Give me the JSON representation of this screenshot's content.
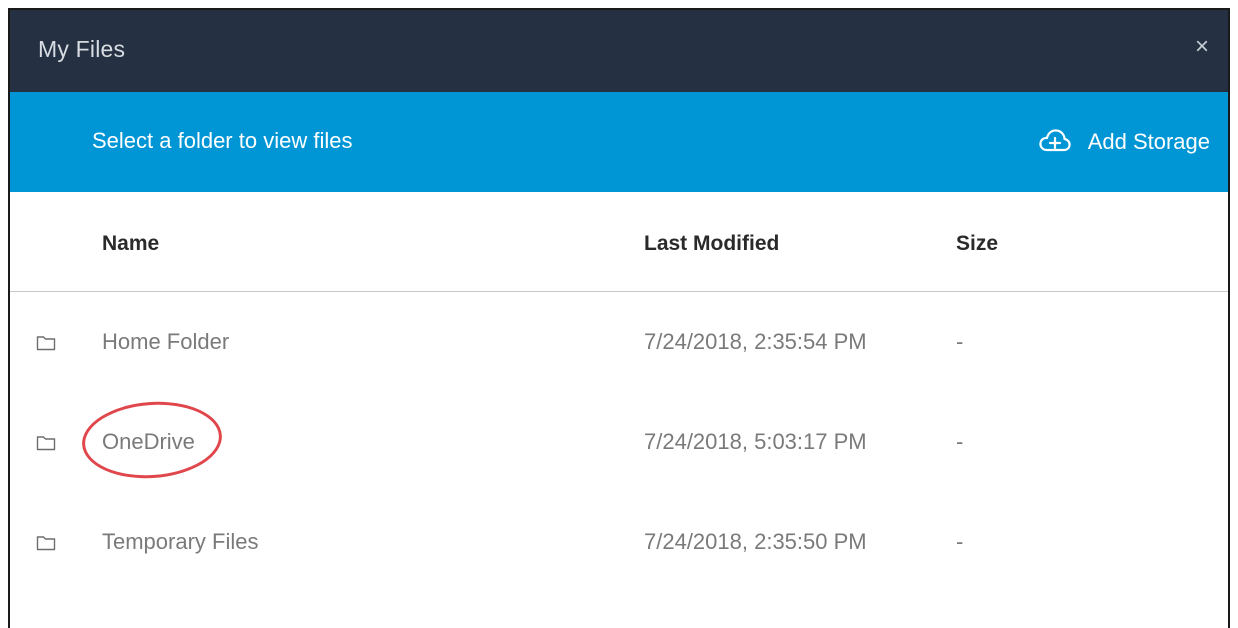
{
  "window": {
    "title": "My Files",
    "close_label": "×"
  },
  "toolbar": {
    "hint": "Select a folder to view files",
    "add_storage_label": "Add Storage",
    "add_storage_icon": "cloud-plus-icon"
  },
  "table": {
    "columns": {
      "name": "Name",
      "last_modified": "Last Modified",
      "size": "Size"
    },
    "rows": [
      {
        "icon": "folder-icon",
        "name": "Home Folder",
        "last_modified": "7/24/2018, 2:35:54 PM",
        "size": "-"
      },
      {
        "icon": "folder-icon",
        "name": "OneDrive",
        "last_modified": "7/24/2018, 5:03:17 PM",
        "size": "-"
      },
      {
        "icon": "folder-icon",
        "name": "Temporary Files",
        "last_modified": "7/24/2018, 2:35:50 PM",
        "size": "-"
      }
    ]
  },
  "colors": {
    "titlebar": "#253142",
    "accent": "#0096d6",
    "annotation": "#e0474c"
  }
}
